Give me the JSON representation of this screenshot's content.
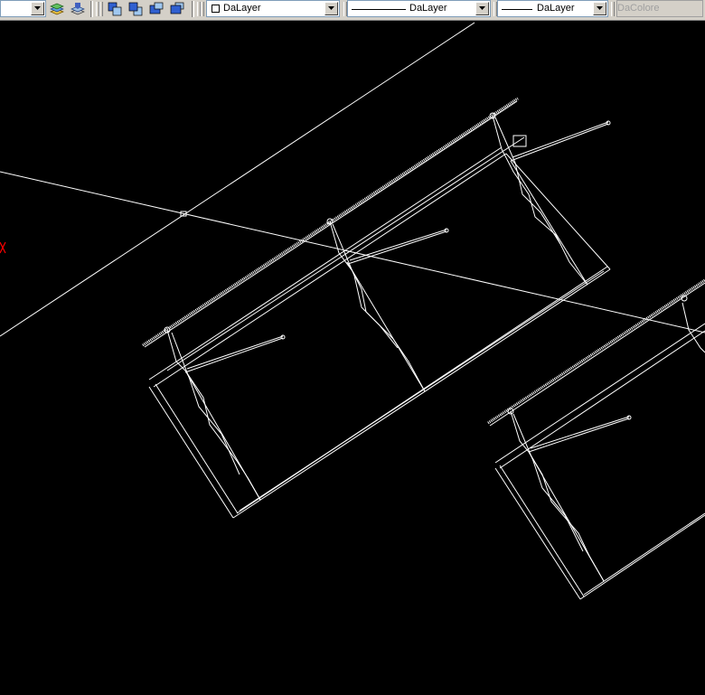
{
  "toolbar": {
    "layer_color_label": "DaLayer",
    "linetype_label": "DaLayer",
    "lineweight_label": "DaLayer",
    "plotstyle_label": "DaColore"
  },
  "colors": {
    "toolbar_bg": "#d4d0c8",
    "canvas_bg": "#000000",
    "geometry": "#ffffff",
    "ucs_marker": "#ff0000"
  },
  "icons": [
    "layer-previous-icon",
    "layer-state-icon",
    "bring-front-icon",
    "send-back-icon",
    "bring-above-icon",
    "send-under-icon",
    "chevron-down-icon"
  ]
}
